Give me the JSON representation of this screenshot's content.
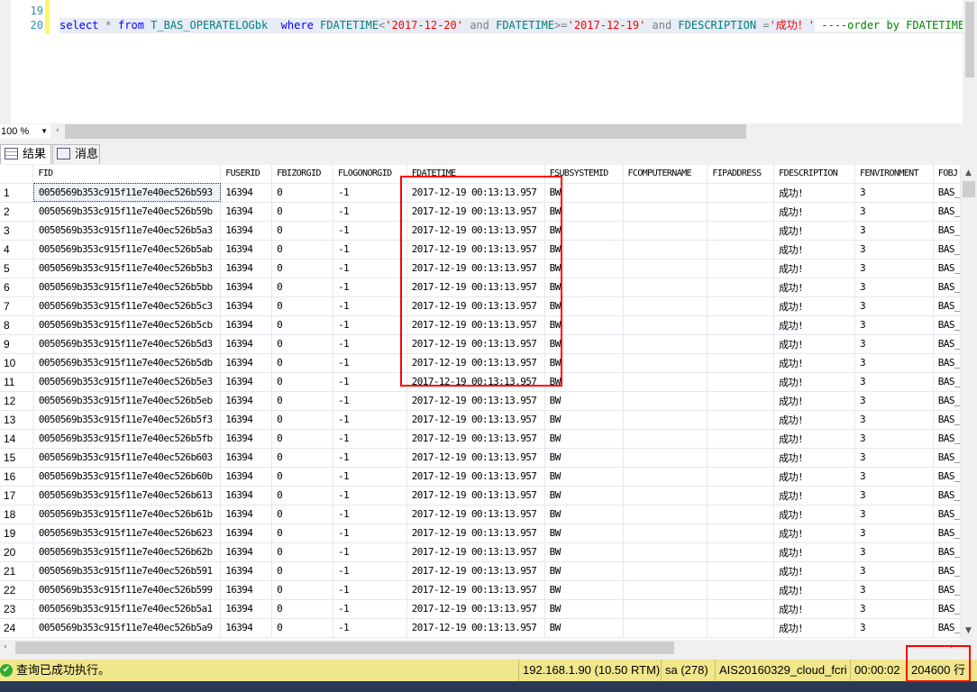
{
  "editor": {
    "line_numbers": [
      "19",
      "20"
    ],
    "code": {
      "select": "select",
      "star": " * ",
      "from": "from",
      "table": " T_BAS_OPERATELOGbk  ",
      "where": "where",
      "col1": " FDATETIME",
      "lt": "<",
      "v1": "'2017-12-20'",
      "and1": " and ",
      "col2": "FDATETIME",
      "ge": ">=",
      "v2": "'2017-12-19'",
      "and2": " and ",
      "col3": "FDESCRIPTION ",
      "eq": "=",
      "v3": "'成功！'",
      "comment": " ----order by FDATETIME"
    }
  },
  "zoom": {
    "value": "100 %"
  },
  "tabs": [
    {
      "label": "结果",
      "icon": "grid-icon"
    },
    {
      "label": "消息",
      "icon": "messages-icon"
    }
  ],
  "grid": {
    "columns": [
      "",
      "FID",
      "FUSERID",
      "FBIZORGID",
      "FLOGONORGID",
      "FDATETIME",
      "FSUBSYSTEMID",
      "FCOMPUTERNAME",
      "FIPADDRESS",
      "FDESCRIPTION",
      "FENVIRONMENT",
      "FOBJ"
    ],
    "common": {
      "FUSERID": "16394",
      "FBIZORGID": "0",
      "FLOGONORGID": "-1",
      "FDATETIME": "2017-12-19 00:13:13.957",
      "FSUBSYSTEMID": "BW",
      "FCOMPUTERNAME": "",
      "FIPADDRESS": "",
      "FDESCRIPTION": "成功!",
      "FENVIRONMENT": "3",
      "FOBJ": "BAS_"
    },
    "fids": [
      "0050569b353c915f11e7e40ec526b593",
      "0050569b353c915f11e7e40ec526b59b",
      "0050569b353c915f11e7e40ec526b5a3",
      "0050569b353c915f11e7e40ec526b5ab",
      "0050569b353c915f11e7e40ec526b5b3",
      "0050569b353c915f11e7e40ec526b5bb",
      "0050569b353c915f11e7e40ec526b5c3",
      "0050569b353c915f11e7e40ec526b5cb",
      "0050569b353c915f11e7e40ec526b5d3",
      "0050569b353c915f11e7e40ec526b5db",
      "0050569b353c915f11e7e40ec526b5e3",
      "0050569b353c915f11e7e40ec526b5eb",
      "0050569b353c915f11e7e40ec526b5f3",
      "0050569b353c915f11e7e40ec526b5fb",
      "0050569b353c915f11e7e40ec526b603",
      "0050569b353c915f11e7e40ec526b60b",
      "0050569b353c915f11e7e40ec526b613",
      "0050569b353c915f11e7e40ec526b61b",
      "0050569b353c915f11e7e40ec526b623",
      "0050569b353c915f11e7e40ec526b62b",
      "0050569b353c915f11e7e40ec526b591",
      "0050569b353c915f11e7e40ec526b599",
      "0050569b353c915f11e7e40ec526b5a1",
      "0050569b353c915f11e7e40ec526b5a9"
    ]
  },
  "status": {
    "message": "查询已成功执行。",
    "server": "192.168.1.90 (10.50 RTM)",
    "user": "sa (278)",
    "database": "AIS20160329_cloud_fcri",
    "elapsed": "00:00:02",
    "rows": "204600 行"
  },
  "colors": {
    "status_bg": "#f0e68c",
    "highlight_box": "#ff0000",
    "keyword": "#0000ff",
    "string": "#ff0000",
    "comment": "#008000"
  }
}
